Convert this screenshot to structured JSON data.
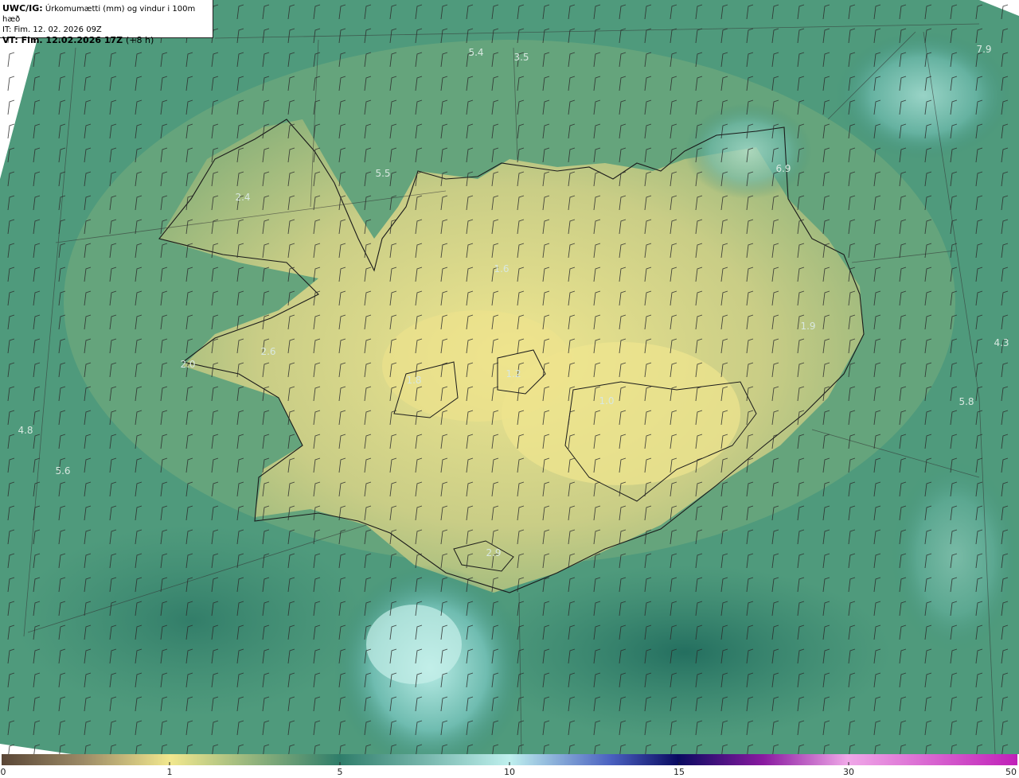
{
  "header": {
    "product": "UWC/IG:",
    "description": "Úrkomumætti (mm) og vindur i 100m hæð",
    "issue_time": "IT: Fim. 12. 02. 2026 09Z",
    "valid_prefix": "VT:",
    "valid_time": "Fim. 12.02.2026 17Z",
    "lead": "(+8 h)"
  },
  "value_labels": [
    "5.4",
    "3.5",
    "7.9",
    "5.5",
    "6.9",
    "2.4",
    "2.6",
    "2.0",
    "4.8",
    "5.6",
    "1.2",
    "1.0",
    "4.3",
    "5.8",
    "2.9",
    "1.6",
    "1.9",
    "1.8"
  ],
  "colorbar": {
    "ticks": [
      "0",
      "1",
      "5",
      "10",
      "15",
      "30",
      "50"
    ],
    "colors": [
      "#5a4636",
      "#bfa97a",
      "#f2e88e",
      "#2f7d6a",
      "#bff0ee",
      "#3040a8",
      "#0a0a60",
      "#8a1aa0",
      "#f0a8e8",
      "#c020b8"
    ]
  },
  "map_colors": {
    "sea": "#2f7d6a",
    "land_low": "#8fb07c",
    "land_high": "#eee48e",
    "cyan_patch": "#9fdcd6",
    "coast": "#1a1a1a"
  }
}
